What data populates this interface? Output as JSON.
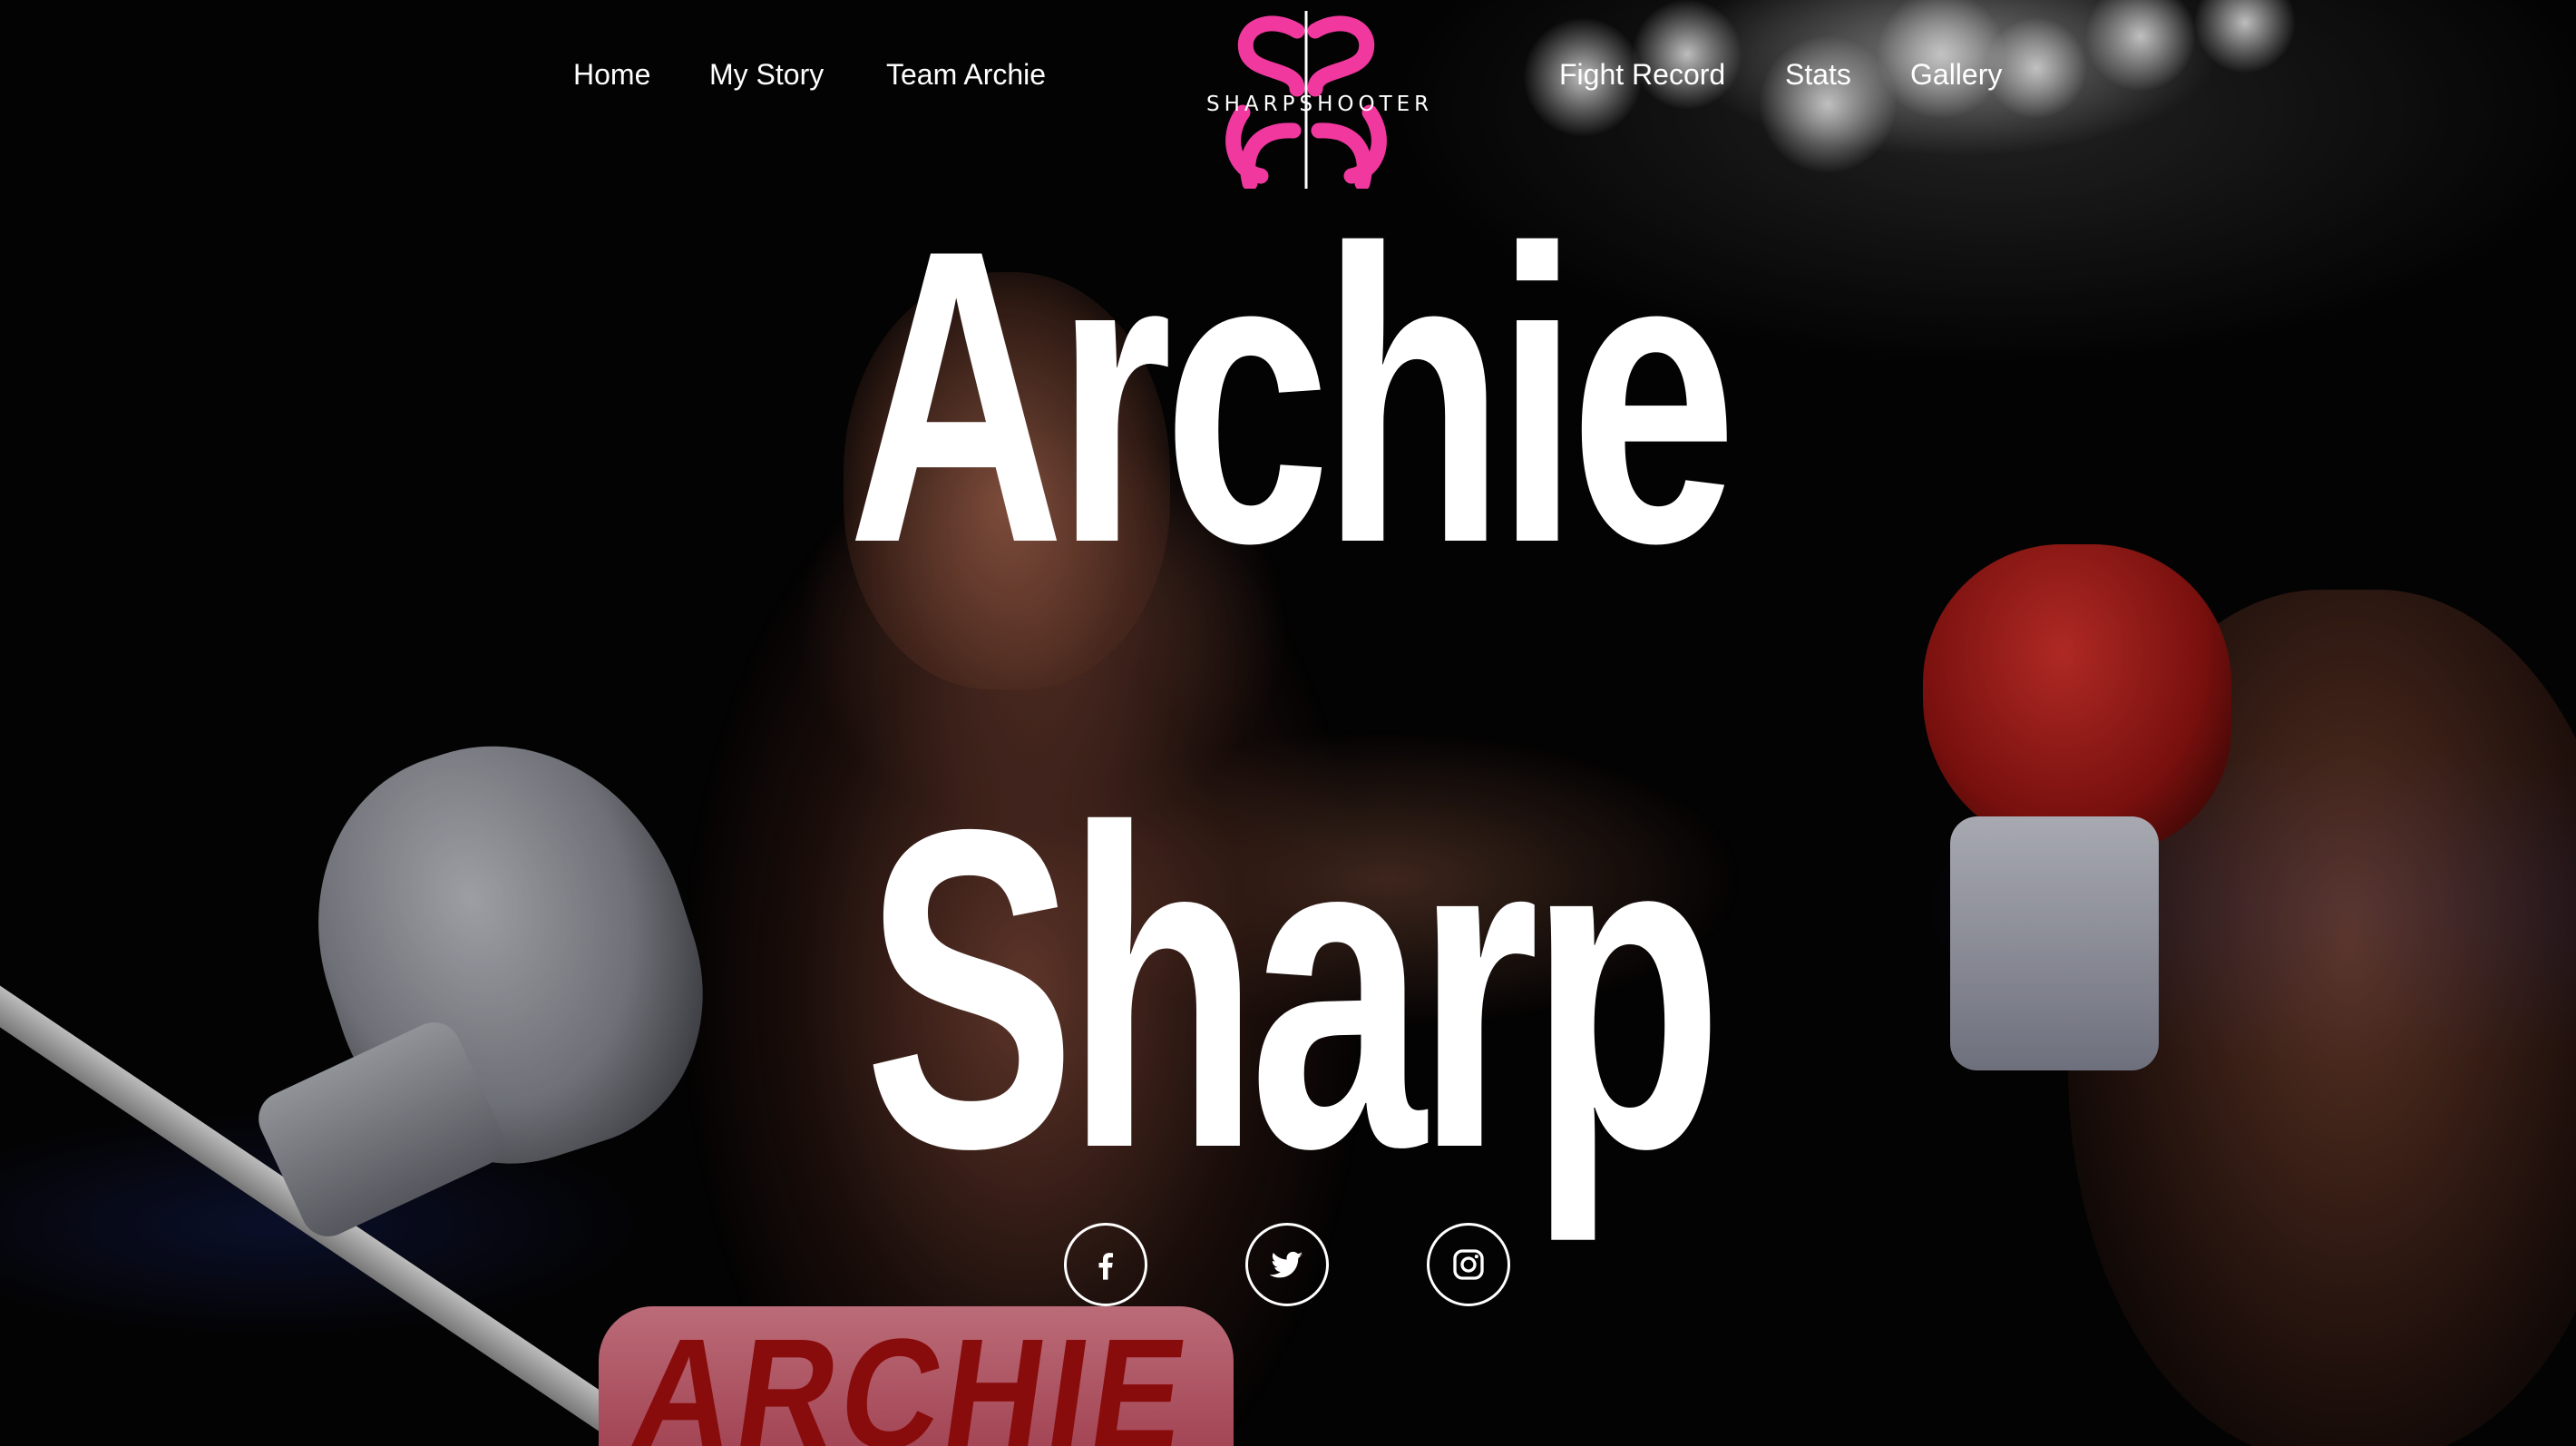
{
  "nav": {
    "left": [
      {
        "label": "Home"
      },
      {
        "label": "My Story"
      },
      {
        "label": "Team Archie"
      }
    ],
    "right": [
      {
        "label": "Fight Record"
      },
      {
        "label": "Stats"
      },
      {
        "label": "Gallery"
      }
    ],
    "logo_text": "SHARPSHOOTER"
  },
  "hero": {
    "title_line1": "Archie",
    "title_line2": "Sharp",
    "trunks_text": "ARCHIE"
  },
  "social": [
    {
      "icon": "facebook-icon"
    },
    {
      "icon": "twitter-icon"
    },
    {
      "icon": "instagram-icon"
    }
  ],
  "colors": {
    "brand_pink": "#f0389e",
    "text": "#ffffff",
    "background": "#000000"
  }
}
